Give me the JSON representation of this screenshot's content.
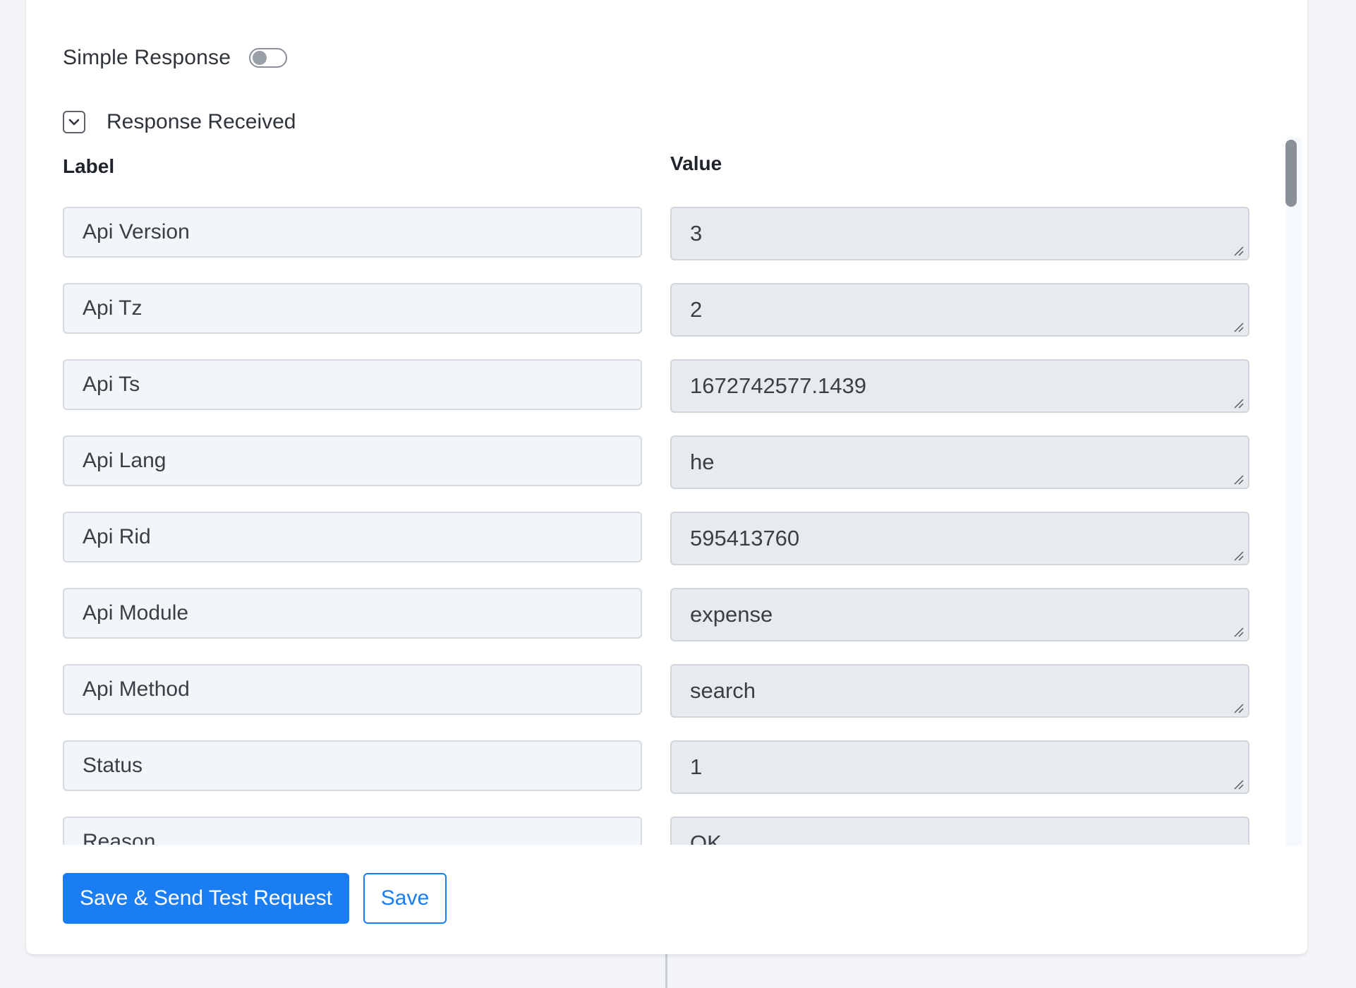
{
  "simple_response": {
    "label": "Simple Response",
    "enabled": false
  },
  "response_received": {
    "label": "Response Received",
    "expanded": true
  },
  "columns": {
    "label": "Label",
    "value": "Value"
  },
  "rows": [
    {
      "label": "Api Version",
      "value": "3"
    },
    {
      "label": "Api Tz",
      "value": "2"
    },
    {
      "label": "Api Ts",
      "value": "1672742577.1439"
    },
    {
      "label": "Api Lang",
      "value": "he"
    },
    {
      "label": "Api Rid",
      "value": "595413760"
    },
    {
      "label": "Api Module",
      "value": "expense"
    },
    {
      "label": "Api Method",
      "value": "search"
    },
    {
      "label": "Status",
      "value": "1"
    },
    {
      "label": "Reason",
      "value": "OK"
    }
  ],
  "buttons": {
    "save_send": "Save & Send Test Request",
    "save": "Save"
  },
  "colors": {
    "primary": "#1a7ef2",
    "label_bg": "#f3f6f9",
    "value_bg": "#e8ebee"
  }
}
